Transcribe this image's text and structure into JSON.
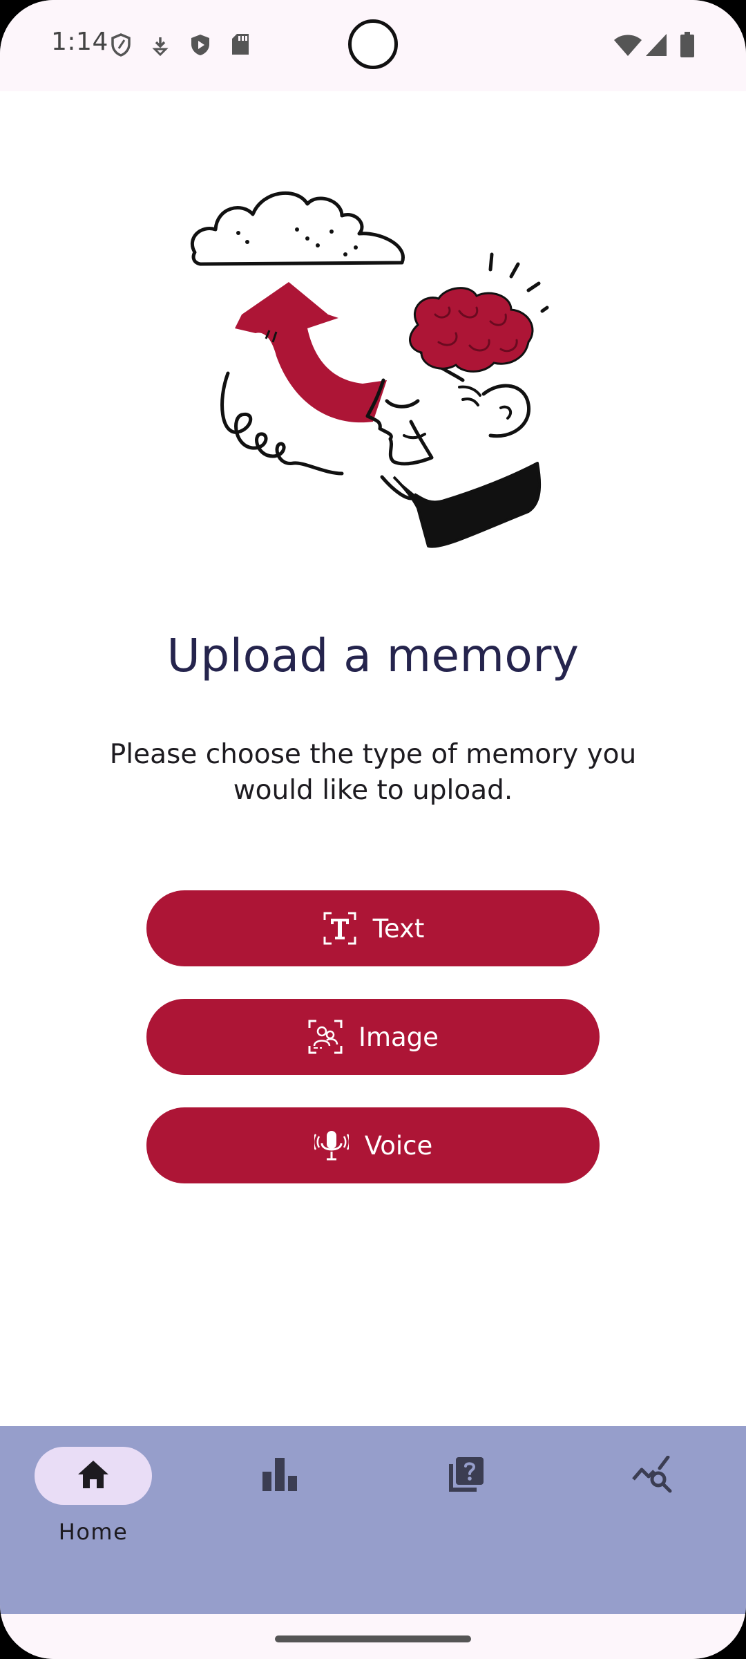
{
  "status_bar": {
    "time": "1:14",
    "left_icons": [
      "vpn-shield-icon",
      "download-arrow-icon",
      "play-protect-icon",
      "sd-card-icon"
    ],
    "right_icons": [
      "wifi-icon",
      "signal-icon",
      "battery-icon"
    ]
  },
  "main": {
    "title": "Upload a memory",
    "subtitle": "Please choose the type of memory you would like to upload.",
    "buttons": [
      {
        "label": "Text",
        "icon": "text-icon"
      },
      {
        "label": "Image",
        "icon": "image-scan-icon"
      },
      {
        "label": "Voice",
        "icon": "microphone-icon"
      }
    ]
  },
  "bottom_nav": {
    "items": [
      {
        "label": "Home",
        "icon": "home-icon",
        "selected": true
      },
      {
        "label": "",
        "icon": "bar-chart-icon",
        "selected": false
      },
      {
        "label": "",
        "icon": "quiz-icon",
        "selected": false
      },
      {
        "label": "",
        "icon": "insights-icon",
        "selected": false
      }
    ]
  },
  "colors": {
    "accent": "#ad1536",
    "title": "#25244d",
    "nav_bg": "#969ecb",
    "nav_pill": "#e9ddf6"
  }
}
